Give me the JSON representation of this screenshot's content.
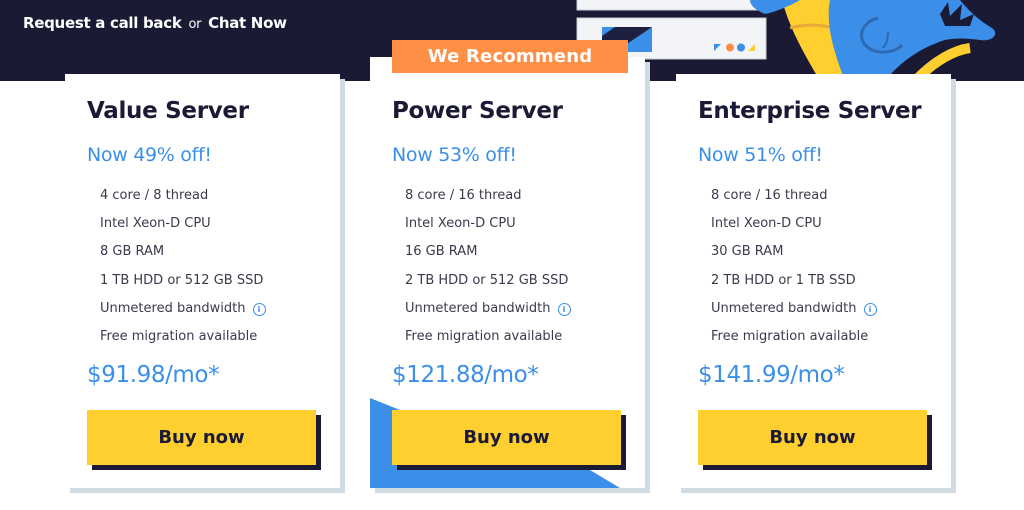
{
  "header": {
    "callback_link": "Request a call back",
    "or_text": "or",
    "chat_link": "Chat Now"
  },
  "colors": {
    "navy": "#1b1a35",
    "accent_blue": "#3b8fe8",
    "orange": "#fd8f47",
    "yellow": "#fecf2f",
    "card_shadow": "#d1dbe2"
  },
  "badge": {
    "label": "We Recommend"
  },
  "plans": [
    {
      "name": "Value Server",
      "discount": "Now 49% off!",
      "features": [
        "4 core / 8 thread",
        "Intel Xeon-D CPU",
        "8 GB RAM",
        "1 TB HDD or 512 GB SSD",
        "Unmetered bandwidth",
        "Free migration available"
      ],
      "price": "$91.98/mo*",
      "cta": "Buy now"
    },
    {
      "name": "Power Server",
      "discount": "Now 53% off!",
      "features": [
        "8 core / 16 thread",
        "Intel Xeon-D CPU",
        "16 GB RAM",
        "2 TB HDD or 512 GB SSD",
        "Unmetered bandwidth",
        "Free migration available"
      ],
      "price": "$121.88/mo*",
      "cta": "Buy now"
    },
    {
      "name": "Enterprise Server",
      "discount": "Now 51% off!",
      "features": [
        "8 core / 16 thread",
        "Intel Xeon-D CPU",
        "30 GB RAM",
        "2 TB HDD or 1 TB SSD",
        "Unmetered bandwidth",
        "Free migration available"
      ],
      "price": "$141.99/mo*",
      "cta": "Buy now"
    }
  ],
  "icons": {
    "info": "info-icon",
    "info_glyph": "i"
  }
}
